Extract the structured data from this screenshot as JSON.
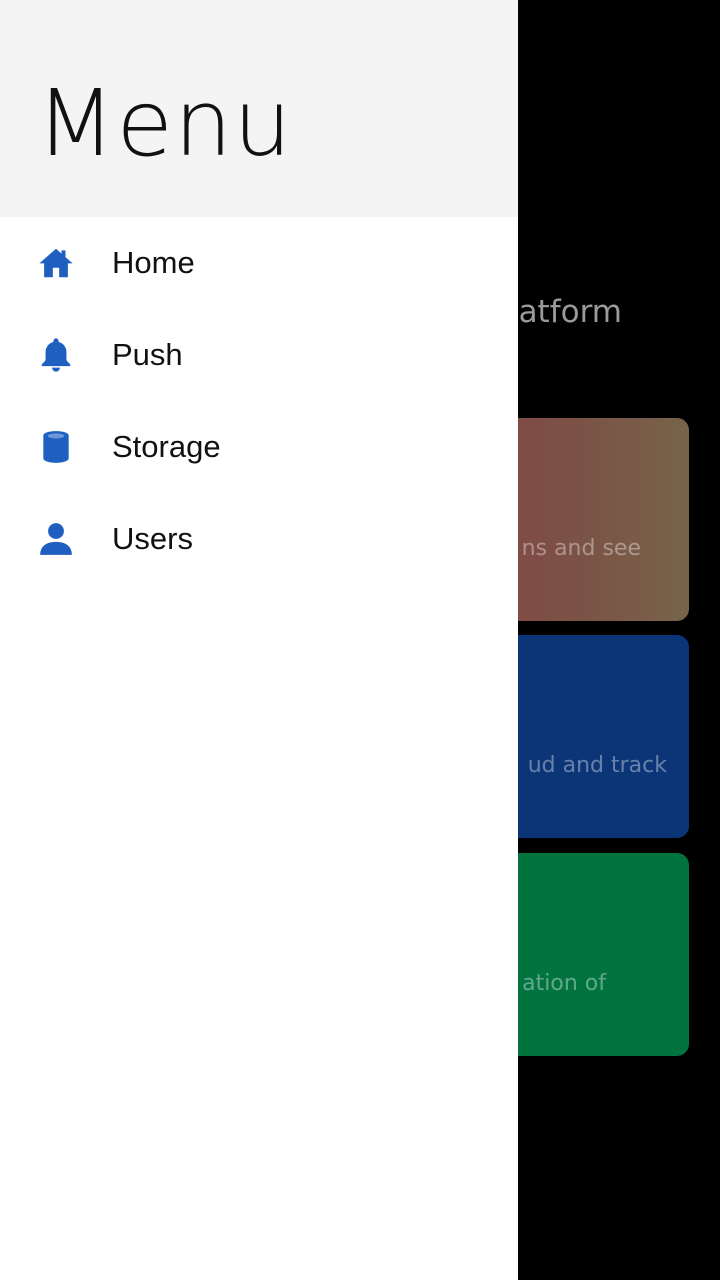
{
  "background": {
    "heading_fragment": "atform",
    "cards": [
      {
        "text_fragment": "ns and see",
        "color": "#7b5145"
      },
      {
        "text_fragment": "ud and track",
        "color": "#0b3577"
      },
      {
        "text_fragment": "ation of",
        "color": "#01733f"
      }
    ]
  },
  "drawer": {
    "title": "Menu",
    "accent_color": "#1f5fbf",
    "items": [
      {
        "label": "Home",
        "icon": "home-icon"
      },
      {
        "label": "Push",
        "icon": "bell-icon"
      },
      {
        "label": "Storage",
        "icon": "database-icon"
      },
      {
        "label": "Users",
        "icon": "user-icon"
      }
    ]
  }
}
